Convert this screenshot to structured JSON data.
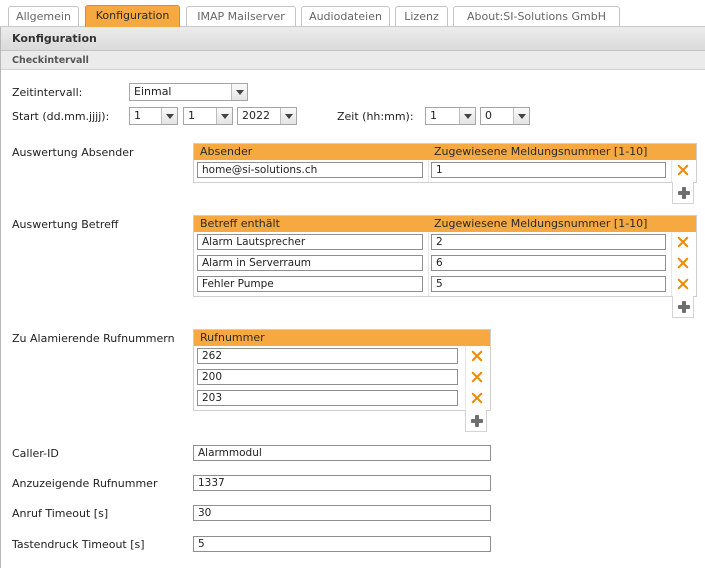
{
  "tabs": [
    {
      "label": "Allgemein",
      "active": false
    },
    {
      "label": "Konfiguration",
      "active": true
    },
    {
      "label": "IMAP Mailserver",
      "active": false
    },
    {
      "label": "Audiodateien",
      "active": false
    },
    {
      "label": "Lizenz",
      "active": false
    },
    {
      "label": "About:SI-Solutions GmbH",
      "active": false
    }
  ],
  "section_title": "Konfiguration",
  "subsection_title": "Checkintervall",
  "zeitintervall": {
    "label": "Zeitintervall:",
    "value": "Einmal"
  },
  "start": {
    "label": "Start (dd.mm.jjjj):",
    "day": "1",
    "month": "1",
    "year": "2022"
  },
  "zeit": {
    "label": "Zeit (hh:mm):",
    "hour": "1",
    "minute": "0"
  },
  "absender": {
    "label": "Auswertung Absender",
    "col1": "Absender",
    "col2": "Zugewiesene Meldungsnummer [1-10]",
    "rows": [
      {
        "value": "home@si-solutions.ch",
        "number": "1"
      }
    ]
  },
  "betreff": {
    "label": "Auswertung Betreff",
    "col1": "Betreff enthält",
    "col2": "Zugewiesene Meldungsnummer [1-10]",
    "rows": [
      {
        "value": "Alarm Lautsprecher",
        "number": "2"
      },
      {
        "value": "Alarm in Serverraum",
        "number": "6"
      },
      {
        "value": "Fehler Pumpe",
        "number": "5"
      }
    ]
  },
  "rufnummern": {
    "label": "Zu Alamierende Rufnummern",
    "col1": "Rufnummer",
    "rows": [
      "262",
      "200",
      "203"
    ]
  },
  "caller_id": {
    "label": "Caller-ID",
    "value": "Alarmmodul"
  },
  "anzuzeigende": {
    "label": "Anzuzeigende Rufnummer",
    "value": "1337"
  },
  "anruf_timeout": {
    "label": "Anruf Timeout [s]",
    "value": "30"
  },
  "tastendruck_timeout": {
    "label": "Tastendruck Timeout [s]",
    "value": "5"
  },
  "colors": {
    "accent": "#f5a940",
    "delete": "#f08a00",
    "header_bg": "#dadada"
  }
}
